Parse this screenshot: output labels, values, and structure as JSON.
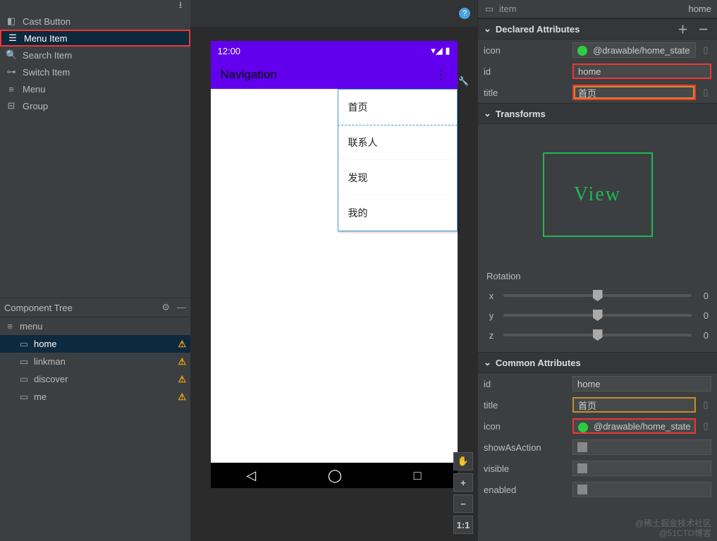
{
  "palette": {
    "items": [
      {
        "label": "Cast Button",
        "icon": "cast"
      },
      {
        "label": "Menu Item",
        "icon": "list",
        "selected": true
      },
      {
        "label": "Search Item",
        "icon": "search"
      },
      {
        "label": "Switch Item",
        "icon": "switch"
      },
      {
        "label": "Menu",
        "icon": "menu"
      },
      {
        "label": "Group",
        "icon": "group"
      }
    ]
  },
  "componentTree": {
    "title": "Component Tree",
    "root": {
      "label": "menu",
      "icon": "menu"
    },
    "children": [
      {
        "label": "home",
        "warn": true,
        "selected": true
      },
      {
        "label": "linkman",
        "warn": true
      },
      {
        "label": "discover",
        "warn": true
      },
      {
        "label": "me",
        "warn": true
      }
    ]
  },
  "preview": {
    "clock": "12:00",
    "appTitle": "Navigation",
    "menuItems": [
      "首页",
      "联系人",
      "发现",
      "我的"
    ]
  },
  "attributes": {
    "topTag": "item",
    "topId": "home",
    "declared": {
      "title": "Declared Attributes",
      "rows": [
        {
          "name": "icon",
          "value": "@drawable/home_state",
          "drawable": true
        },
        {
          "name": "id",
          "value": "home",
          "hi": "red"
        },
        {
          "name": "title",
          "value": "首页",
          "hi": "redamber"
        }
      ]
    },
    "transforms": {
      "title": "Transforms",
      "viewLabel": "View",
      "rotationLabel": "Rotation",
      "axes": [
        {
          "label": "x",
          "value": "0"
        },
        {
          "label": "y",
          "value": "0"
        },
        {
          "label": "z",
          "value": "0"
        }
      ]
    },
    "common": {
      "title": "Common Attributes",
      "rows": [
        {
          "name": "id",
          "value": "home"
        },
        {
          "name": "title",
          "value": "首页",
          "hi": "amber"
        },
        {
          "name": "icon",
          "value": "@drawable/home_state",
          "drawable": true,
          "hi": "red"
        },
        {
          "name": "showAsAction",
          "value": "",
          "flag": true
        },
        {
          "name": "visible",
          "value": "",
          "flag": true
        },
        {
          "name": "enabled",
          "value": "",
          "flag": true
        }
      ]
    }
  },
  "sideTools": {
    "hand": "✋",
    "plus": "+",
    "minus": "−",
    "fit": "1:1"
  },
  "watermark": {
    "l1": "@稀土掘金技术社区",
    "l2": "@51CTO博客"
  }
}
